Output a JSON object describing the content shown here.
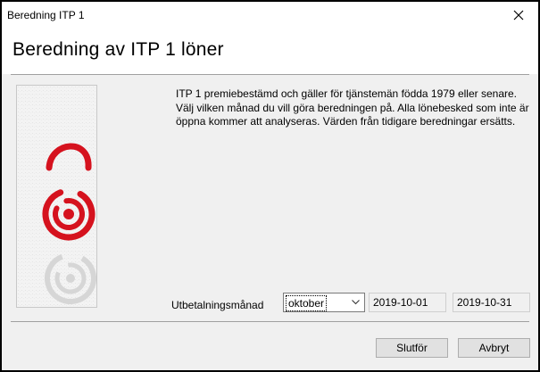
{
  "window": {
    "title": "Beredning ITP 1"
  },
  "header": {
    "title": "Beredning av ITP 1 löner"
  },
  "description": {
    "lines": [
      "ITP 1 premiebestämd och gäller för tjänstemän födda 1979 eller senare.",
      "Välj vilken månad du vill göra beredningen på. Alla lönebesked som inte är",
      "öppna kommer att analyseras. Värden från tidigare beredningar ersätts."
    ]
  },
  "form": {
    "month_label": "Utbetalningsmånad",
    "month_value": "oktober",
    "date_from": "2019-10-01",
    "date_to": "2019-10-31"
  },
  "buttons": {
    "finish": "Slutför",
    "cancel": "Avbryt"
  },
  "icons": {
    "close": "close-icon",
    "dropdown": "chevron-down-icon",
    "logo": "red-logo-image"
  },
  "colors": {
    "logo_red": "#d5121e",
    "watermark_grey": "#d6d6d6"
  }
}
